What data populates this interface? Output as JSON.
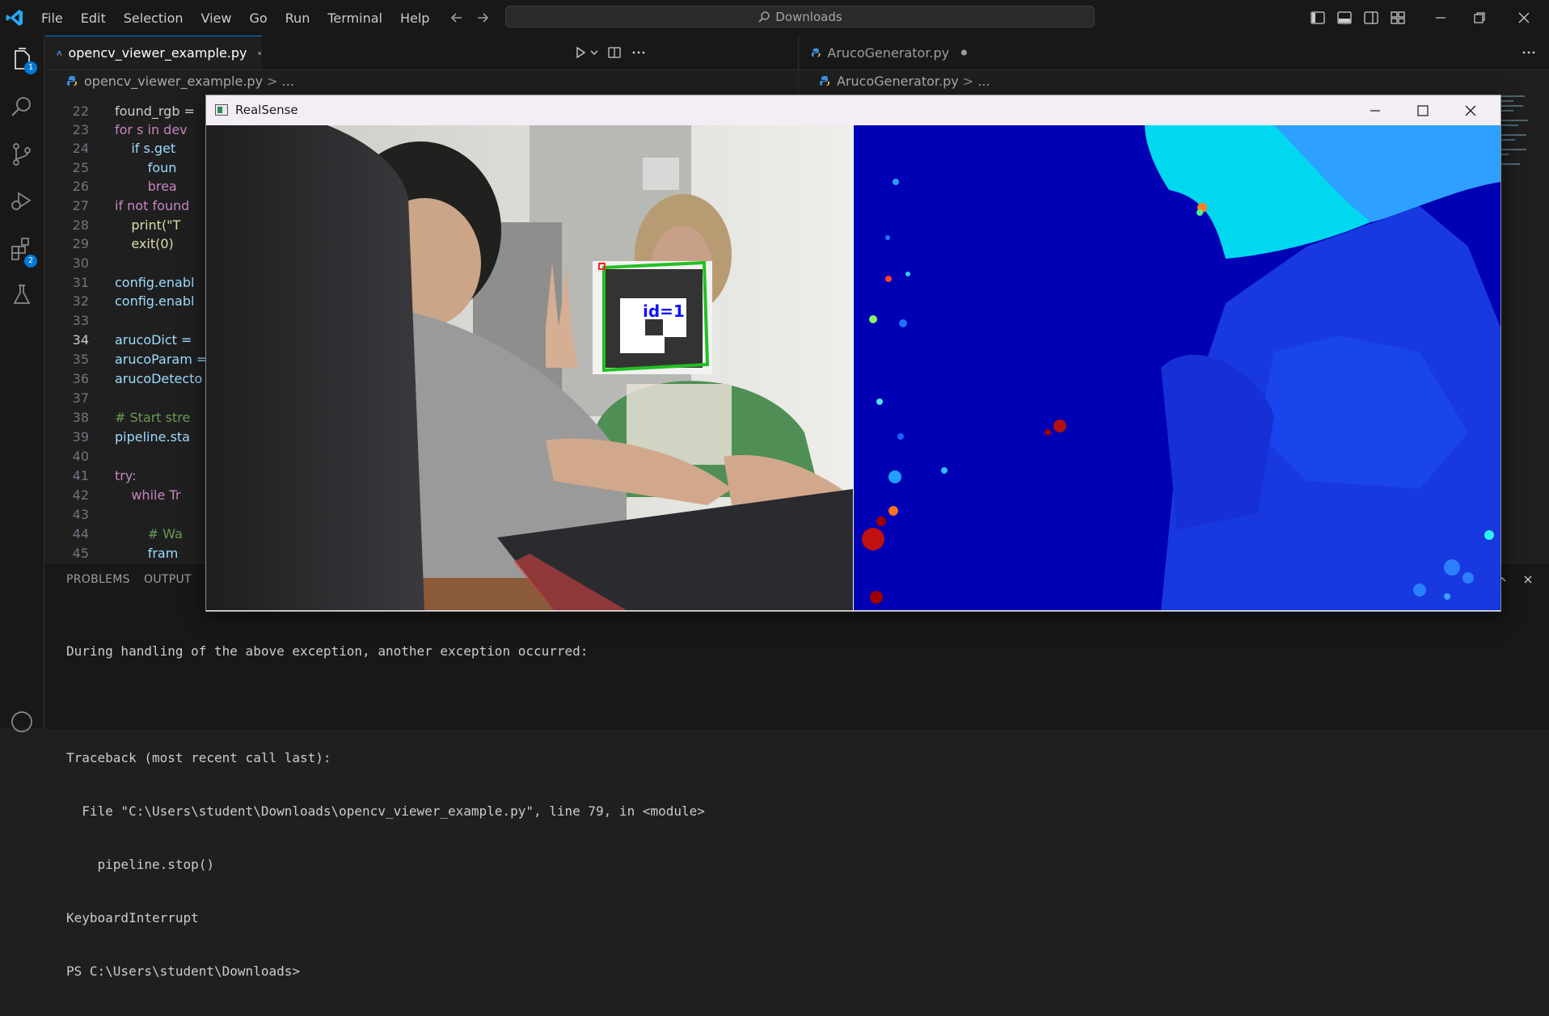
{
  "menu": [
    "File",
    "Edit",
    "Selection",
    "View",
    "Go",
    "Run",
    "Terminal",
    "Help"
  ],
  "search": {
    "text": "Downloads"
  },
  "activity": {
    "explorer_badge": "1",
    "extensions_badge": "2"
  },
  "editor_left": {
    "tab_label": "opencv_viewer_example.py",
    "breadcrumb_file": "opencv_viewer_example.py",
    "breadcrumb_more": "...",
    "lines": [
      {
        "n": "22",
        "t": "found_rgb = "
      },
      {
        "n": "23",
        "t": "for s in dev"
      },
      {
        "n": "24",
        "t": "    if s.get"
      },
      {
        "n": "25",
        "t": "        foun"
      },
      {
        "n": "26",
        "t": "        brea"
      },
      {
        "n": "27",
        "t": "if not found"
      },
      {
        "n": "28",
        "t": "    print(\"T"
      },
      {
        "n": "29",
        "t": "    exit(0)"
      },
      {
        "n": "30",
        "t": ""
      },
      {
        "n": "31",
        "t": "config.enabl"
      },
      {
        "n": "32",
        "t": "config.enabl"
      },
      {
        "n": "33",
        "t": ""
      },
      {
        "n": "34",
        "t": "arucoDict = "
      },
      {
        "n": "35",
        "t": "arucoParam ="
      },
      {
        "n": "36",
        "t": "arucoDetecto"
      },
      {
        "n": "37",
        "t": ""
      },
      {
        "n": "38",
        "t": "# Start stre"
      },
      {
        "n": "39",
        "t": "pipeline.sta"
      },
      {
        "n": "40",
        "t": ""
      },
      {
        "n": "41",
        "t": "try:"
      },
      {
        "n": "42",
        "t": "    while Tr"
      },
      {
        "n": "43",
        "t": ""
      },
      {
        "n": "44",
        "t": "        # Wa"
      },
      {
        "n": "45",
        "t": "        fram"
      }
    ],
    "current_line": "34"
  },
  "editor_right": {
    "tab_label": "ArucoGenerator.py",
    "breadcrumb_file": "ArucoGenerator.py",
    "breadcrumb_more": "..."
  },
  "panel": {
    "tabs": [
      "PROBLEMS",
      "OUTPUT"
    ],
    "terminal_lines": [
      "During handling of the above exception, another exception occurred:",
      "",
      "Traceback (most recent call last):",
      "  File \"C:\\Users\\student\\Downloads\\opencv_viewer_example.py\", line 79, in <module>",
      "    pipeline.stop()",
      "KeyboardInterrupt",
      "PS C:\\Users\\student\\Downloads>"
    ]
  },
  "realsense": {
    "title": "RealSense",
    "marker_label": "id=1"
  },
  "colors": {
    "accent": "#0078d4",
    "background": "#1f1f1f",
    "marker_outline": "#22c022",
    "marker_text": "#1010ff",
    "depth_base": "#0000b8"
  }
}
